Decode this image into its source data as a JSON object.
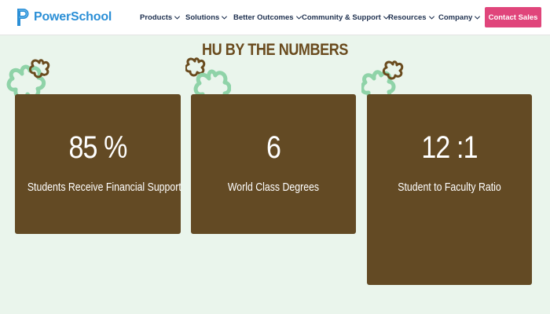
{
  "brand": {
    "name": "PowerSchool"
  },
  "nav": [
    {
      "label": "Products"
    },
    {
      "label": "Solutions"
    },
    {
      "label": "Better Outcomes"
    },
    {
      "label": "Community & Support"
    },
    {
      "label": "Resources"
    },
    {
      "label": "Company"
    }
  ],
  "cta": {
    "label": "Contact Sales"
  },
  "section": {
    "title": "HU BY THE NUMBERS"
  },
  "stats": [
    {
      "value": "85 %",
      "label": "Students Receive Financial Support"
    },
    {
      "value": "6",
      "label": "World Class Degrees"
    },
    {
      "value": "12 :1",
      "label": "Student to Faculty Ratio"
    }
  ],
  "colors": {
    "background": "#eaf5ec",
    "card": "#634a24",
    "heading": "#6a4b1e",
    "cta": "#e0457b",
    "brand": "#2b8fd6",
    "nav_text": "#1d2f4e",
    "deco_green": "#8fd3a8",
    "deco_brown": "#6a4b1e"
  },
  "icons": [
    "powerschool-logo-icon",
    "chevron-down-icon",
    "flower-outline-icon"
  ]
}
